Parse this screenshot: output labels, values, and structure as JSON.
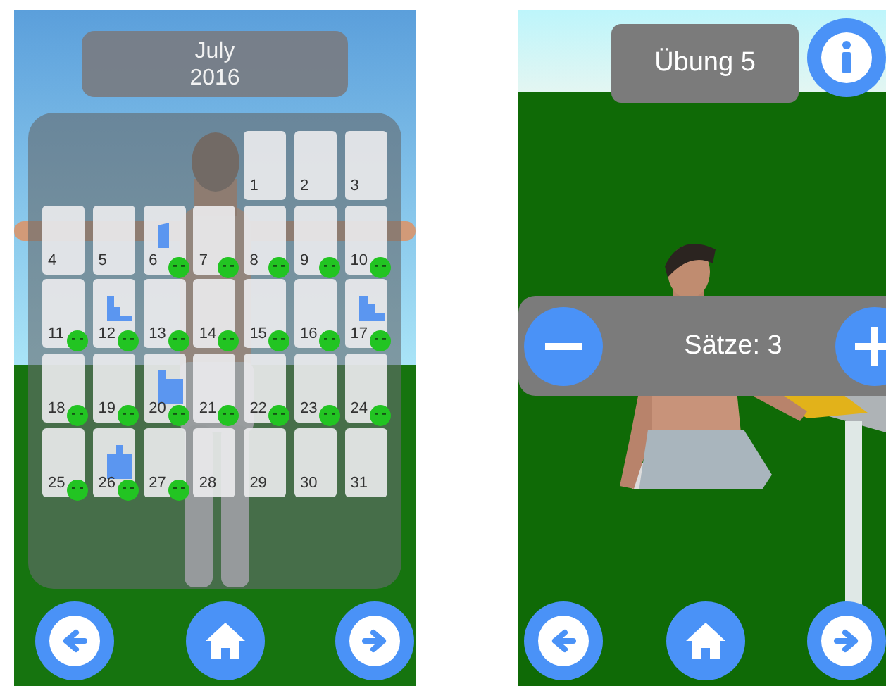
{
  "left_screen": {
    "header": {
      "month": "July",
      "year": "2016"
    },
    "calendar": {
      "days": [
        {
          "kind": "empty"
        },
        {
          "kind": "empty"
        },
        {
          "kind": "empty"
        },
        {
          "kind": "empty"
        },
        {
          "kind": "day",
          "label": "1",
          "smiley": false
        },
        {
          "kind": "day",
          "label": "2",
          "smiley": false
        },
        {
          "kind": "day",
          "label": "3",
          "smiley": false
        },
        {
          "kind": "day",
          "label": "4",
          "smiley": false
        },
        {
          "kind": "day",
          "label": "5",
          "smiley": false
        },
        {
          "kind": "day",
          "label": "6",
          "smiley": true,
          "chart": {
            "kind": "block"
          }
        },
        {
          "kind": "day",
          "label": "7",
          "smiley": true
        },
        {
          "kind": "day",
          "label": "8",
          "smiley": true
        },
        {
          "kind": "day",
          "label": "9",
          "smiley": true
        },
        {
          "kind": "day",
          "label": "10",
          "smiley": true
        },
        {
          "kind": "day",
          "label": "11",
          "smiley": true
        },
        {
          "kind": "day",
          "label": "12",
          "smiley": true,
          "chart": {
            "kind": "tall-left"
          }
        },
        {
          "kind": "day",
          "label": "13",
          "smiley": true
        },
        {
          "kind": "day",
          "label": "14",
          "smiley": true
        },
        {
          "kind": "day",
          "label": "15",
          "smiley": true
        },
        {
          "kind": "day",
          "label": "16",
          "smiley": true
        },
        {
          "kind": "day",
          "label": "17",
          "smiley": true,
          "chart": {
            "kind": "steps-down"
          }
        },
        {
          "kind": "day",
          "label": "18",
          "smiley": true
        },
        {
          "kind": "day",
          "label": "19",
          "smiley": true
        },
        {
          "kind": "day",
          "label": "20",
          "smiley": true,
          "chart": {
            "kind": "step-up"
          }
        },
        {
          "kind": "day",
          "label": "21",
          "smiley": true
        },
        {
          "kind": "day",
          "label": "22",
          "smiley": true
        },
        {
          "kind": "day",
          "label": "23",
          "smiley": true
        },
        {
          "kind": "day",
          "label": "24",
          "smiley": true
        },
        {
          "kind": "day",
          "label": "25",
          "smiley": true
        },
        {
          "kind": "day",
          "label": "26",
          "smiley": true,
          "chart": {
            "kind": "towers"
          }
        },
        {
          "kind": "day",
          "label": "27",
          "smiley": true
        },
        {
          "kind": "day",
          "label": "28",
          "smiley": false
        },
        {
          "kind": "day",
          "label": "29",
          "smiley": false
        },
        {
          "kind": "day",
          "label": "30",
          "smiley": false
        },
        {
          "kind": "day",
          "label": "31",
          "smiley": false
        }
      ]
    },
    "nav": [
      {
        "kind": "back"
      },
      {
        "kind": "home"
      },
      {
        "kind": "forward"
      }
    ]
  },
  "right_screen": {
    "title": "Übung 5",
    "info_button": {
      "kind": "info"
    },
    "sets": {
      "label": "Sätze: 3",
      "controls": [
        {
          "kind": "minus"
        },
        {
          "kind": "plus"
        }
      ]
    },
    "nav": [
      {
        "kind": "back"
      },
      {
        "kind": "home"
      },
      {
        "kind": "forward"
      }
    ]
  }
}
